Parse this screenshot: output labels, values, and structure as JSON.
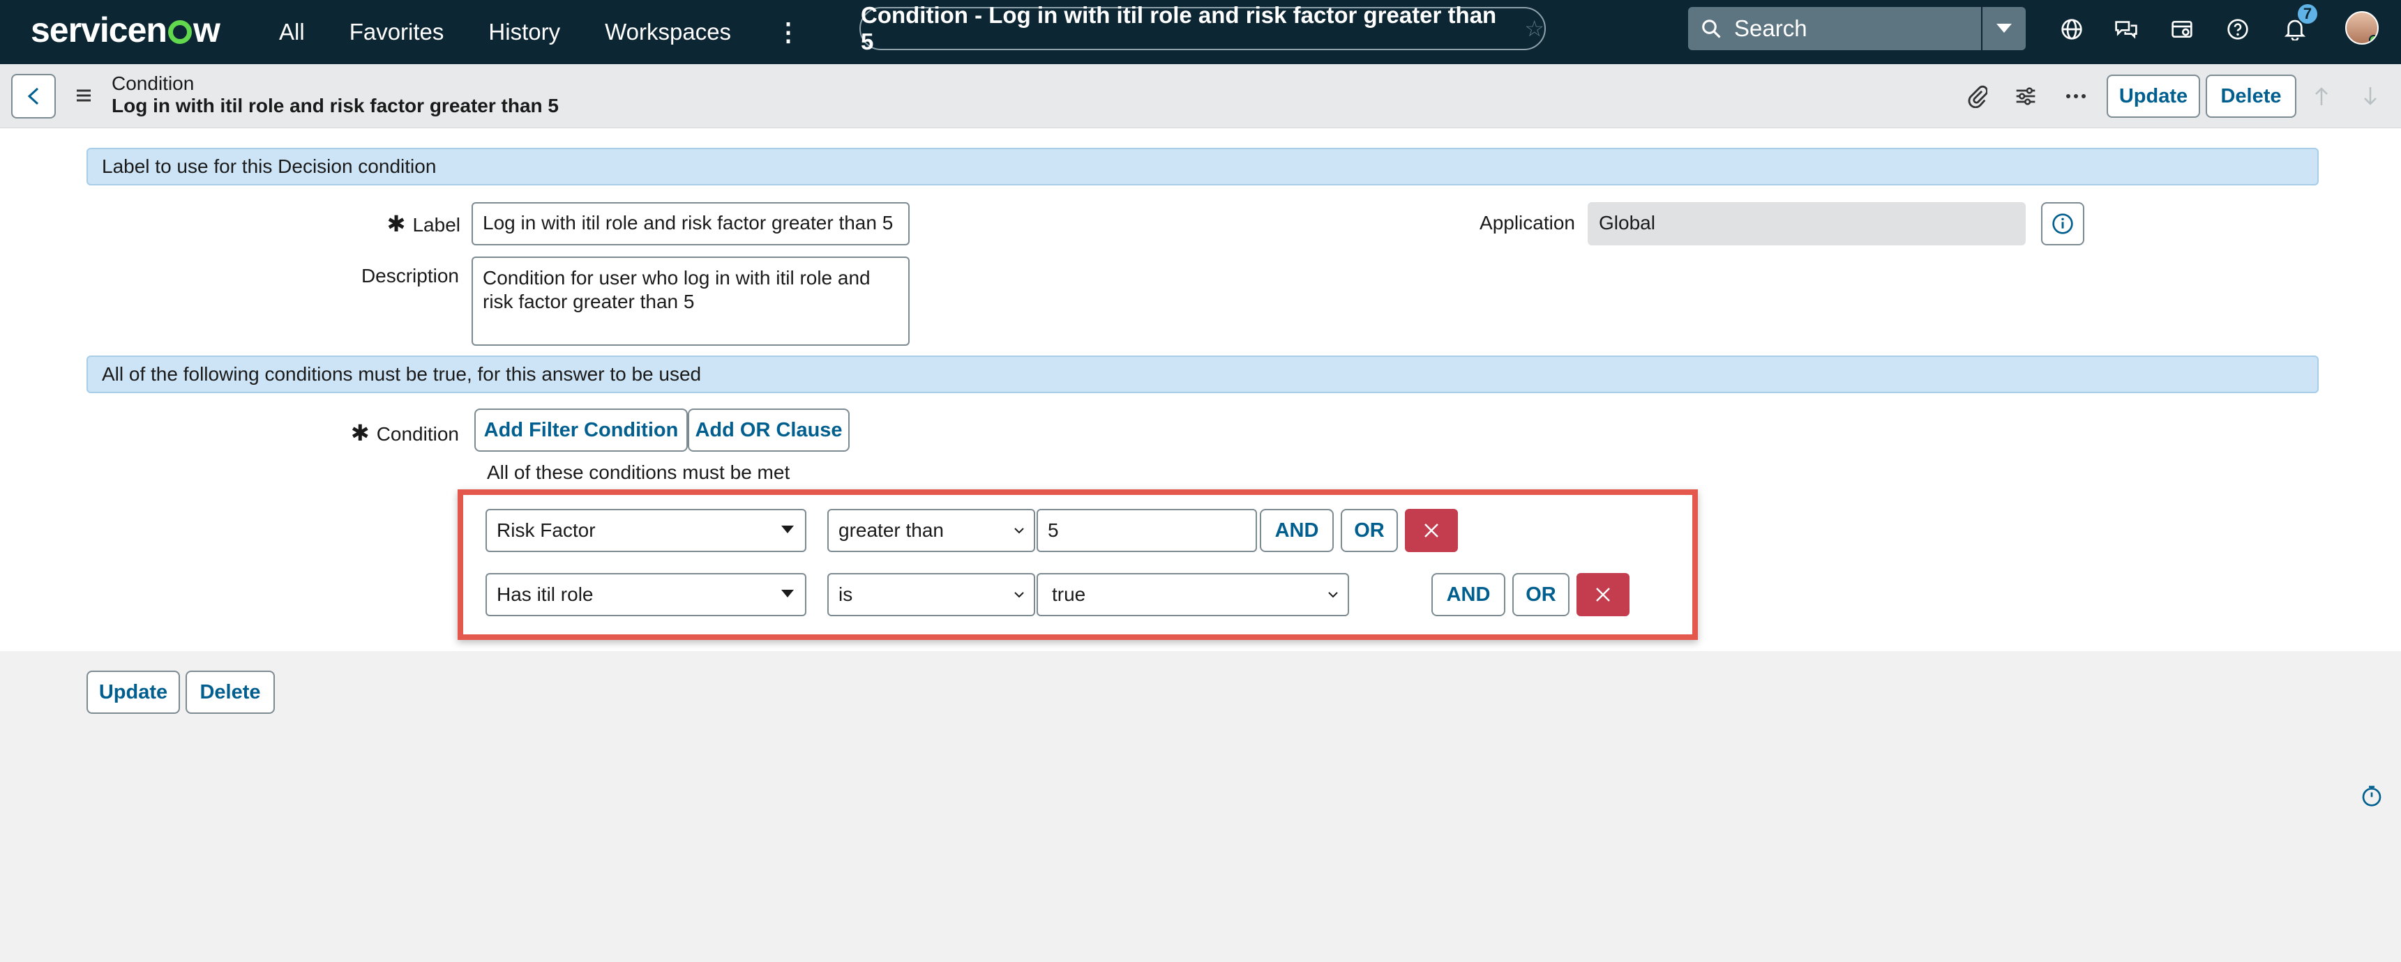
{
  "topnav": {
    "logo_text": "servicenow",
    "links": [
      "All",
      "Favorites",
      "History",
      "Workspaces"
    ],
    "title": "Condition - Log in with itil role and risk factor greater than 5",
    "search_placeholder": "Search",
    "notification_count": "7",
    "accent_color": "#62d84e"
  },
  "header": {
    "record_type": "Condition",
    "record_name": "Log in with itil role and risk factor greater than 5",
    "update_label": "Update",
    "delete_label": "Delete"
  },
  "form": {
    "section1_title": "Label to use for this Decision condition",
    "label_label": "Label",
    "label_value": "Log in with itil role and risk factor greater than 5",
    "description_label": "Description",
    "description_value": "Condition for user who log in with itil role and risk factor greater than 5",
    "application_label": "Application",
    "application_value": "Global",
    "section2_title": "All of the following conditions must be true, for this answer to be used",
    "condition_label": "Condition",
    "add_filter_label": "Add Filter Condition",
    "add_or_label": "Add OR Clause",
    "conditions_note": "All of these conditions must be met",
    "rows": [
      {
        "field": "Risk Factor",
        "operator": "greater than",
        "value": "5",
        "and": "AND",
        "or": "OR"
      },
      {
        "field": "Has itil role",
        "operator": "is",
        "value": "true",
        "and": "AND",
        "or": "OR"
      }
    ]
  },
  "footer": {
    "update_label": "Update",
    "delete_label": "Delete"
  }
}
